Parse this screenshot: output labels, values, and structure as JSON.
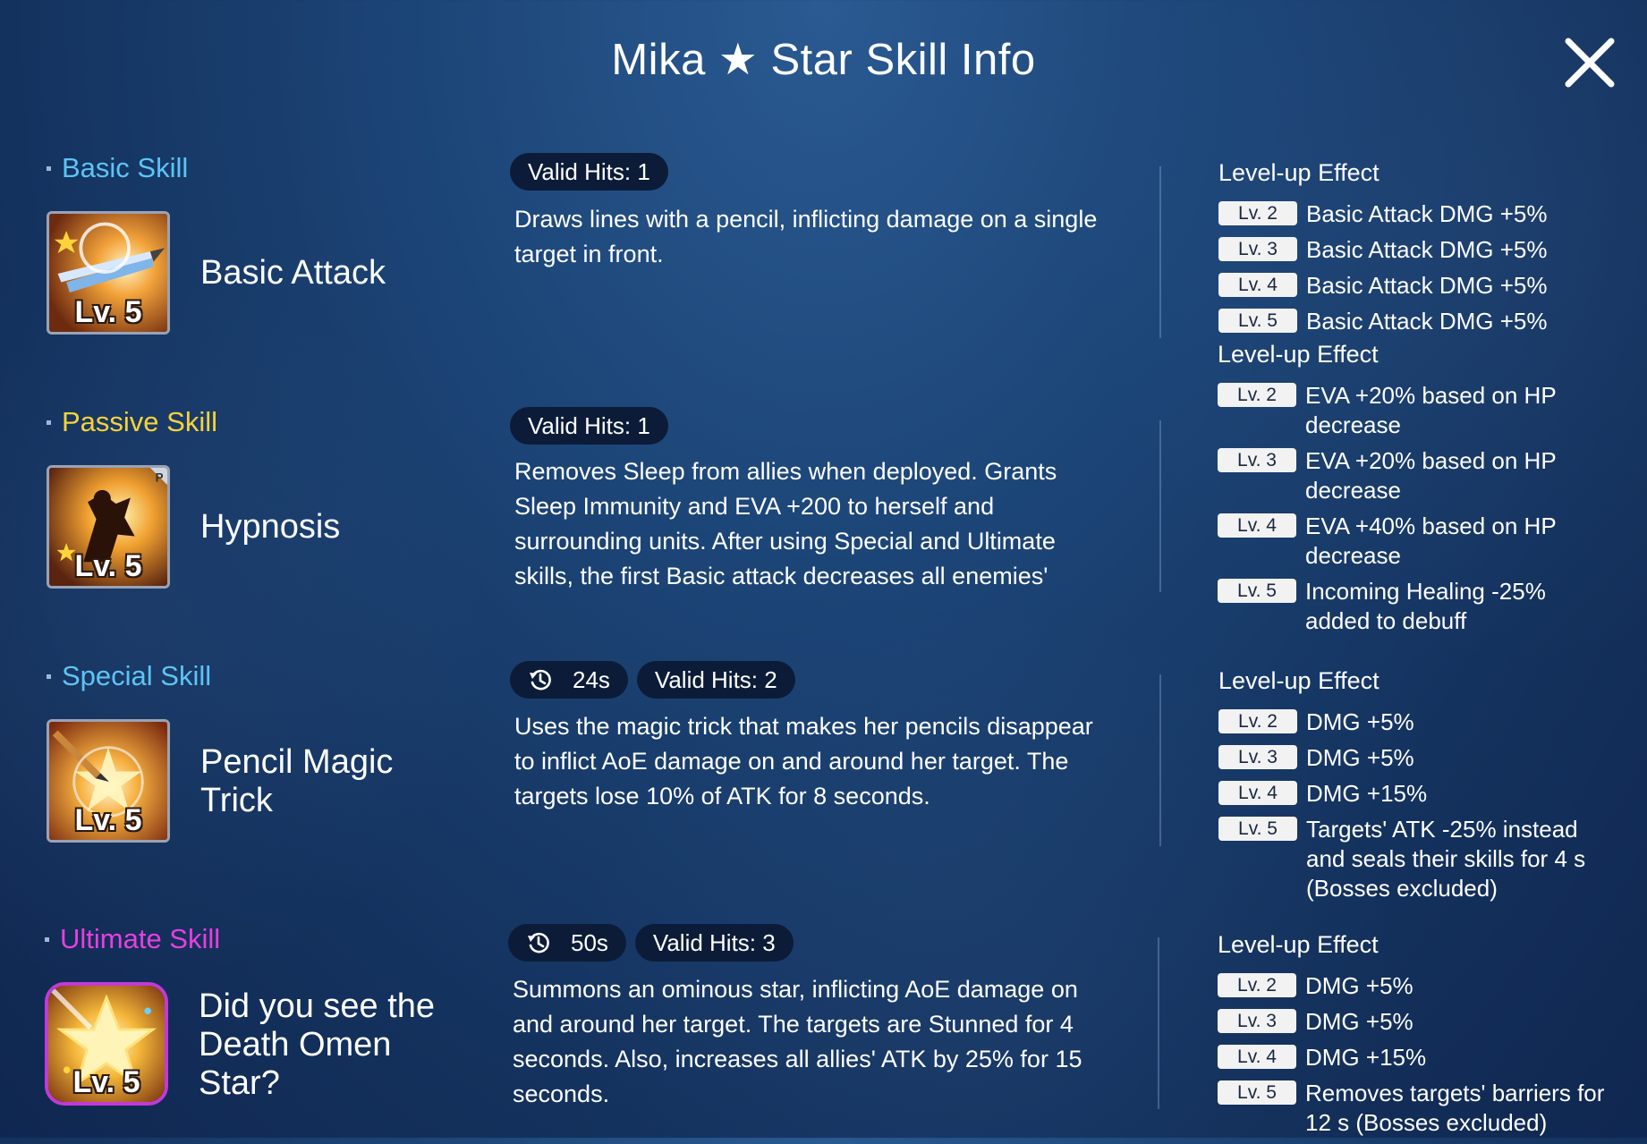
{
  "title": "Mika ★ Star Skill Info",
  "close_icon": "close-icon",
  "skills": [
    {
      "type_label": "Basic Skill",
      "type_color": "#5ec4f5",
      "icon": "basic-attack-icon",
      "level": "Lv. 5",
      "name": "Basic Attack",
      "cooldown": "",
      "valid_hits": "Valid Hits: 1",
      "description": "Draws lines with a pencil, inflicting damage on a single target in front.",
      "levelup_title": "Level-up Effect",
      "levelups": [
        {
          "tag": "Lv. 2",
          "text": "Basic Attack DMG +5%"
        },
        {
          "tag": "Lv. 3",
          "text": "Basic Attack DMG +5%"
        },
        {
          "tag": "Lv. 4",
          "text": "Basic Attack DMG +5%"
        },
        {
          "tag": "Lv. 5",
          "text": "Basic Attack DMG +5%"
        }
      ]
    },
    {
      "type_label": "Passive Skill",
      "type_color": "#f7d23a",
      "icon": "hypnosis-icon",
      "level": "Lv. 5",
      "name": "Hypnosis",
      "cooldown": "",
      "valid_hits": "Valid Hits: 1",
      "description": "Removes Sleep from allies when deployed. Grants Sleep Immunity and EVA +200 to herself and surrounding units. After using Special and Ultimate skills, the first Basic attack decreases all enemies'",
      "levelup_title": "Level-up Effect",
      "levelups": [
        {
          "tag": "Lv. 2",
          "text": "EVA +20% based on HP decrease"
        },
        {
          "tag": "Lv. 3",
          "text": "EVA +20% based on HP decrease"
        },
        {
          "tag": "Lv. 4",
          "text": "EVA +40% based on HP decrease"
        },
        {
          "tag": "Lv. 5",
          "text": "Incoming Healing -25% added to debuff"
        }
      ]
    },
    {
      "type_label": "Special Skill",
      "type_color": "#5ec4f5",
      "icon": "pencil-magic-icon",
      "level": "Lv. 5",
      "name": "Pencil Magic Trick",
      "cooldown": "24s",
      "valid_hits": "Valid Hits: 2",
      "description": "Uses the magic trick that makes her pencils disappear to inflict AoE damage on and around her target. The targets lose 10% of ATK for 8 seconds.",
      "levelup_title": "Level-up Effect",
      "levelups": [
        {
          "tag": "Lv. 2",
          "text": "DMG +5%"
        },
        {
          "tag": "Lv. 3",
          "text": "DMG +5%"
        },
        {
          "tag": "Lv. 4",
          "text": "DMG +15%"
        },
        {
          "tag": "Lv. 5",
          "text": "Targets' ATK -25% instead and seals their skills for 4 s (Bosses excluded)"
        }
      ]
    },
    {
      "type_label": "Ultimate Skill",
      "type_color": "#e83fe0",
      "icon": "death-omen-star-icon",
      "level": "Lv. 5",
      "name": "Did you see the Death Omen Star?",
      "cooldown": "50s",
      "valid_hits": "Valid Hits: 3",
      "description": "Summons an ominous star, inflicting AoE damage on and around her target. The targets are Stunned for 4 seconds. Also, increases all allies' ATK by 25% for 15 seconds.",
      "levelup_title": "Level-up Effect",
      "levelups": [
        {
          "tag": "Lv. 2",
          "text": "DMG +5%"
        },
        {
          "tag": "Lv. 3",
          "text": "DMG +5%"
        },
        {
          "tag": "Lv. 4",
          "text": "DMG +15%"
        },
        {
          "tag": "Lv. 5",
          "text": "Removes targets' barriers for 12 s (Bosses excluded)"
        }
      ]
    }
  ]
}
